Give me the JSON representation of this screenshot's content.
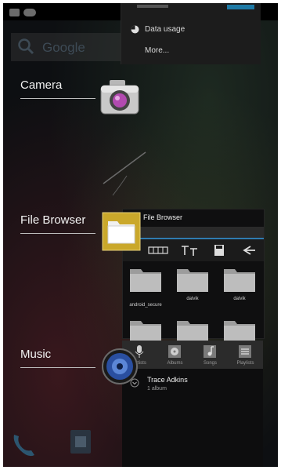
{
  "search": {
    "placeholder": "Google"
  },
  "quick_settings": {
    "items": [
      {
        "label": "Data usage",
        "icon": "pie-chart-icon"
      },
      {
        "label": "More..."
      }
    ]
  },
  "recent_apps": [
    {
      "label": "Camera",
      "icon": "camera-icon"
    },
    {
      "label": "File Browser",
      "icon": "folder-icon"
    },
    {
      "label": "Music",
      "icon": "speaker-icon"
    }
  ],
  "file_browser": {
    "title": "File Browser",
    "folders": [
      "android_secure",
      "dalvik",
      "dalvik"
    ]
  },
  "music": {
    "tabs": [
      {
        "label": "Artists",
        "icon": "microphone-icon"
      },
      {
        "label": "Albums",
        "icon": "album-icon"
      },
      {
        "label": "Songs",
        "icon": "note-icon"
      },
      {
        "label": "Playlists",
        "icon": "list-icon"
      }
    ],
    "artist": {
      "name": "Trace Adkins",
      "albums": "1 album"
    }
  },
  "colors": {
    "accent": "#2f7bb0",
    "background": "#0d0f12"
  }
}
